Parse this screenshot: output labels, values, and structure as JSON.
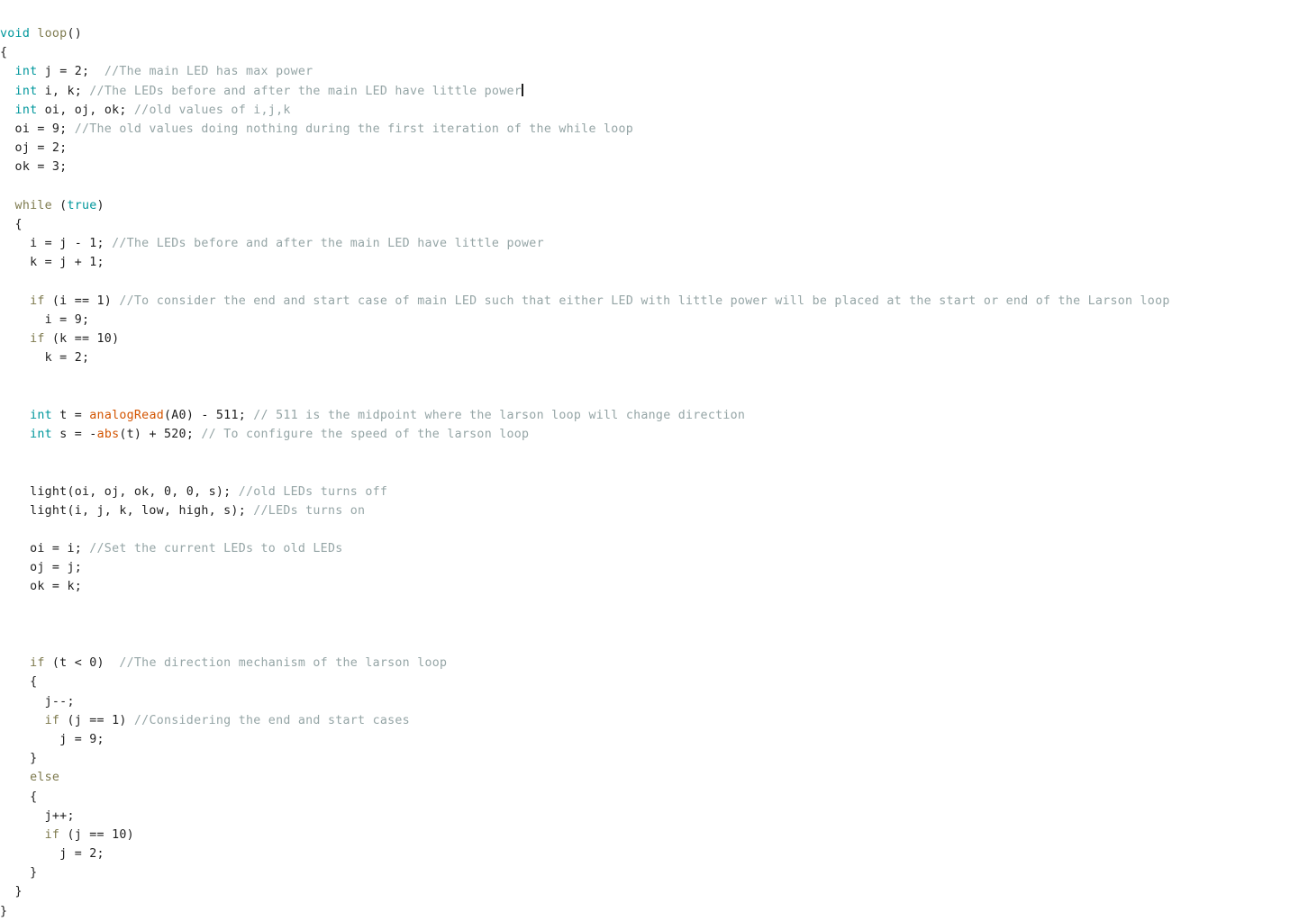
{
  "editor": {
    "title": "Arduino sketch — loop()",
    "language": "arduino-c",
    "colors": {
      "background": "#FFFFFF",
      "plain_text": "#1E1E1E",
      "type_keyword": "#00979C",
      "control_keyword": "#7E7A4E",
      "builtin_function": "#D35400",
      "comment": "#95A5A6",
      "caret": "#1E1E1E"
    },
    "caret_line": 4,
    "caret_after_text": "power"
  },
  "code": {
    "l01": {
      "kw": "void",
      "fn": " loop",
      "rest": "()"
    },
    "l02": {
      "text": "{"
    },
    "l03": {
      "indent": "  ",
      "kw": "int",
      "mid": " j = 2;  ",
      "cmt": "//The main LED has max power"
    },
    "l04": {
      "indent": "  ",
      "kw": "int",
      "mid": " i, k; ",
      "cmt": "//The LEDs before and after the main LED have little power"
    },
    "l05": {
      "indent": "  ",
      "kw": "int",
      "mid": " oi, oj, ok; ",
      "cmt": "//old values of i,j,k"
    },
    "l06": {
      "indent": "  ",
      "mid": "oi = 9; ",
      "cmt": "//The old values doing nothing during the first iteration of the while loop"
    },
    "l07": {
      "indent": "  ",
      "mid": "oj = 2;"
    },
    "l08": {
      "indent": "  ",
      "mid": "ok = 3;"
    },
    "l09": {
      "text": ""
    },
    "l10": {
      "indent": "  ",
      "kw": "while",
      "mid": " (",
      "kw2": "true",
      "rest": ")"
    },
    "l11": {
      "indent": "  ",
      "mid": "{"
    },
    "l12": {
      "indent": "    ",
      "mid": "i = j - 1; ",
      "cmt": "//The LEDs before and after the main LED have little power"
    },
    "l13": {
      "indent": "    ",
      "mid": "k = j + 1;"
    },
    "l14": {
      "text": ""
    },
    "l15": {
      "indent": "    ",
      "kw": "if",
      "mid": " (i == 1) ",
      "cmt": "//To consider the end and start case of main LED such that either LED with little power will be placed at the start or end of the Larson loop"
    },
    "l16": {
      "indent": "      ",
      "mid": "i = 9;"
    },
    "l17": {
      "indent": "    ",
      "kw": "if",
      "mid": " (k == 10)"
    },
    "l18": {
      "indent": "      ",
      "mid": "k = 2;"
    },
    "l19": {
      "text": ""
    },
    "l20": {
      "text": ""
    },
    "l21": {
      "indent": "    ",
      "kw": "int",
      "mid": " t = ",
      "fn": "analogRead",
      "mid2": "(A0) - 511; ",
      "cmt": "// 511 is the midpoint where the larson loop will change direction"
    },
    "l22": {
      "indent": "    ",
      "kw": "int",
      "mid": " s = -",
      "fn": "abs",
      "mid2": "(t) + 520; ",
      "cmt": "// To configure the speed of the larson loop"
    },
    "l23": {
      "text": ""
    },
    "l24": {
      "text": ""
    },
    "l25": {
      "indent": "    ",
      "mid": "light(oi, oj, ok, 0, 0, s); ",
      "cmt": "//old LEDs turns off"
    },
    "l26": {
      "indent": "    ",
      "mid": "light(i, j, k, low, high, s); ",
      "cmt": "//LEDs turns on"
    },
    "l27": {
      "text": ""
    },
    "l28": {
      "indent": "    ",
      "mid": "oi = i; ",
      "cmt": "//Set the current LEDs to old LEDs"
    },
    "l29": {
      "indent": "    ",
      "mid": "oj = j;"
    },
    "l30": {
      "indent": "    ",
      "mid": "ok = k;"
    },
    "l31": {
      "text": ""
    },
    "l32": {
      "text": ""
    },
    "l33": {
      "text": ""
    },
    "l34": {
      "indent": "    ",
      "kw": "if",
      "mid": " (t < 0)  ",
      "cmt": "//The direction mechanism of the larson loop"
    },
    "l35": {
      "indent": "    ",
      "mid": "{"
    },
    "l36": {
      "indent": "      ",
      "mid": "j--;"
    },
    "l37": {
      "indent": "      ",
      "kw": "if",
      "mid": " (j == 1) ",
      "cmt": "//Considering the end and start cases"
    },
    "l38": {
      "indent": "        ",
      "mid": "j = 9;"
    },
    "l39": {
      "indent": "    ",
      "mid": "}"
    },
    "l40": {
      "indent": "    ",
      "kw": "else"
    },
    "l41": {
      "indent": "    ",
      "mid": "{"
    },
    "l42": {
      "indent": "      ",
      "mid": "j++;"
    },
    "l43": {
      "indent": "      ",
      "kw": "if",
      "mid": " (j == 10)"
    },
    "l44": {
      "indent": "        ",
      "mid": "j = 2;"
    },
    "l45": {
      "indent": "    ",
      "mid": "}"
    },
    "l46": {
      "indent": "  ",
      "mid": "}"
    },
    "l47": {
      "text": "}"
    }
  }
}
